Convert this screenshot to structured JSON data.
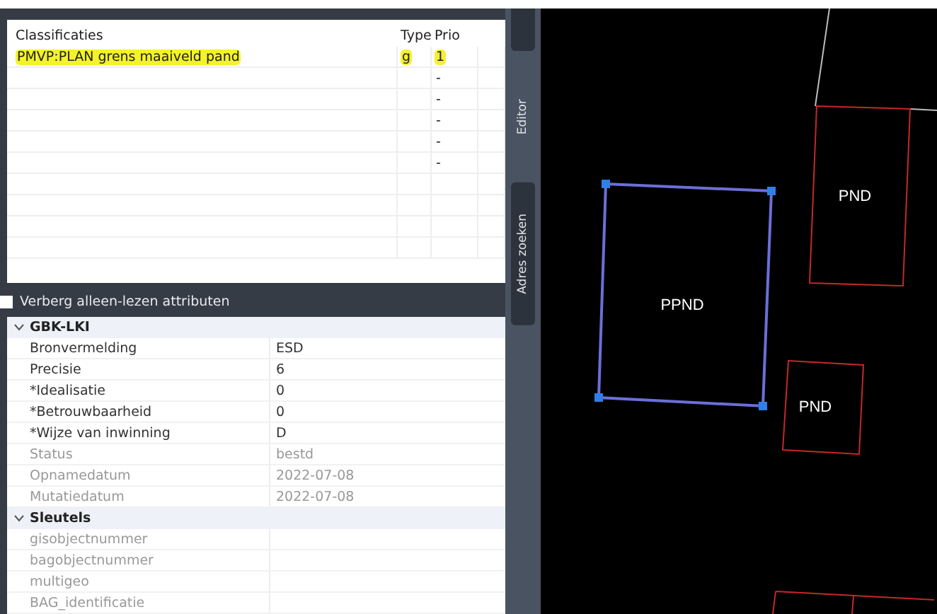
{
  "classifications": {
    "columns": [
      "Classificaties",
      "Type",
      "Prio"
    ],
    "rows": [
      {
        "cells": [
          "PMVP:PLAN grens maaiveld pand",
          "g",
          "1"
        ],
        "highlighted": true
      },
      {
        "cells": [
          "",
          "",
          "-"
        ],
        "highlighted": false
      },
      {
        "cells": [
          "",
          "",
          "-"
        ],
        "highlighted": false
      },
      {
        "cells": [
          "",
          "",
          "-"
        ],
        "highlighted": false
      },
      {
        "cells": [
          "",
          "",
          "-"
        ],
        "highlighted": false
      },
      {
        "cells": [
          "",
          "",
          "-"
        ],
        "highlighted": false
      },
      {
        "cells": [
          "",
          "",
          ""
        ],
        "highlighted": false
      },
      {
        "cells": [
          "",
          "",
          ""
        ],
        "highlighted": false
      },
      {
        "cells": [
          "",
          "",
          ""
        ],
        "highlighted": false
      },
      {
        "cells": [
          "",
          "",
          ""
        ],
        "highlighted": false
      }
    ]
  },
  "hide_readonly": {
    "label": "Verberg alleen-lezen attributen",
    "checked": false
  },
  "properties": [
    {
      "group": "GBK-LKI",
      "expanded": true,
      "rows": [
        {
          "name": "Bronvermelding",
          "value": "ESD",
          "readonly": false
        },
        {
          "name": "Precisie",
          "value": "6",
          "readonly": false
        },
        {
          "name": "*Idealisatie",
          "value": "0",
          "readonly": false
        },
        {
          "name": "*Betrouwbaarheid",
          "value": "0",
          "readonly": false
        },
        {
          "name": "*Wijze van inwinning",
          "value": "D",
          "readonly": false
        },
        {
          "name": "Status",
          "value": "bestd",
          "readonly": true
        },
        {
          "name": "Opnamedatum",
          "value": "2022-07-08",
          "readonly": true
        },
        {
          "name": "Mutatiedatum",
          "value": "2022-07-08",
          "readonly": true
        }
      ]
    },
    {
      "group": "Sleutels",
      "expanded": true,
      "rows": [
        {
          "name": "gisobjectnummer",
          "readonly": true
        },
        {
          "name": "bagobjectnummer",
          "readonly": true
        },
        {
          "name": "multigeo",
          "readonly": true
        },
        {
          "name": "BAG_identificatie",
          "readonly": true
        }
      ]
    }
  ],
  "side_tabs": [
    {
      "label": "Editor",
      "selected": true
    },
    {
      "label": "Adres zoeken",
      "selected": false
    }
  ],
  "map": {
    "features": [
      {
        "label": "PPND",
        "selected": true
      },
      {
        "label": "PND",
        "selected": false
      },
      {
        "label": "PND",
        "selected": false
      }
    ]
  }
}
